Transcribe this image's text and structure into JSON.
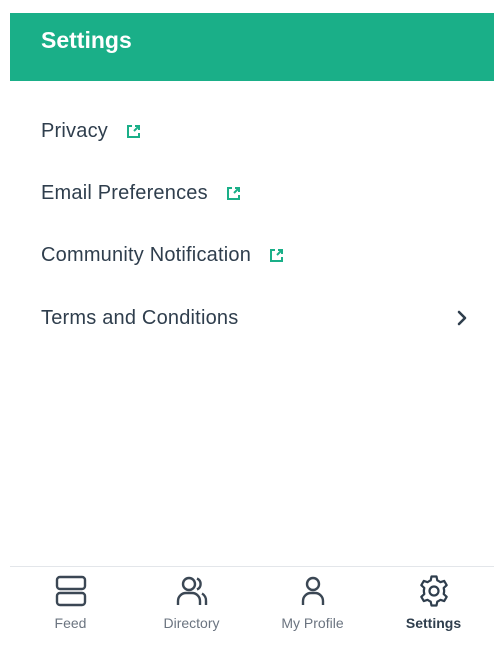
{
  "header": {
    "title": "Settings",
    "bg_color": "#1aaf88"
  },
  "menu": {
    "items": [
      {
        "label": "Privacy",
        "icon": "external-link-icon"
      },
      {
        "label": "Email Preferences",
        "icon": "external-link-icon"
      },
      {
        "label": "Community Notification",
        "icon": "external-link-icon"
      },
      {
        "label": "Terms and Conditions",
        "icon": "chevron-right-icon"
      }
    ]
  },
  "tabbar": {
    "tabs": [
      {
        "label": "Feed",
        "icon": "feed-icon",
        "active": false
      },
      {
        "label": "Directory",
        "icon": "people-icon",
        "active": false
      },
      {
        "label": "My Profile",
        "icon": "person-icon",
        "active": false
      },
      {
        "label": "Settings",
        "icon": "gear-icon",
        "active": true
      }
    ]
  }
}
